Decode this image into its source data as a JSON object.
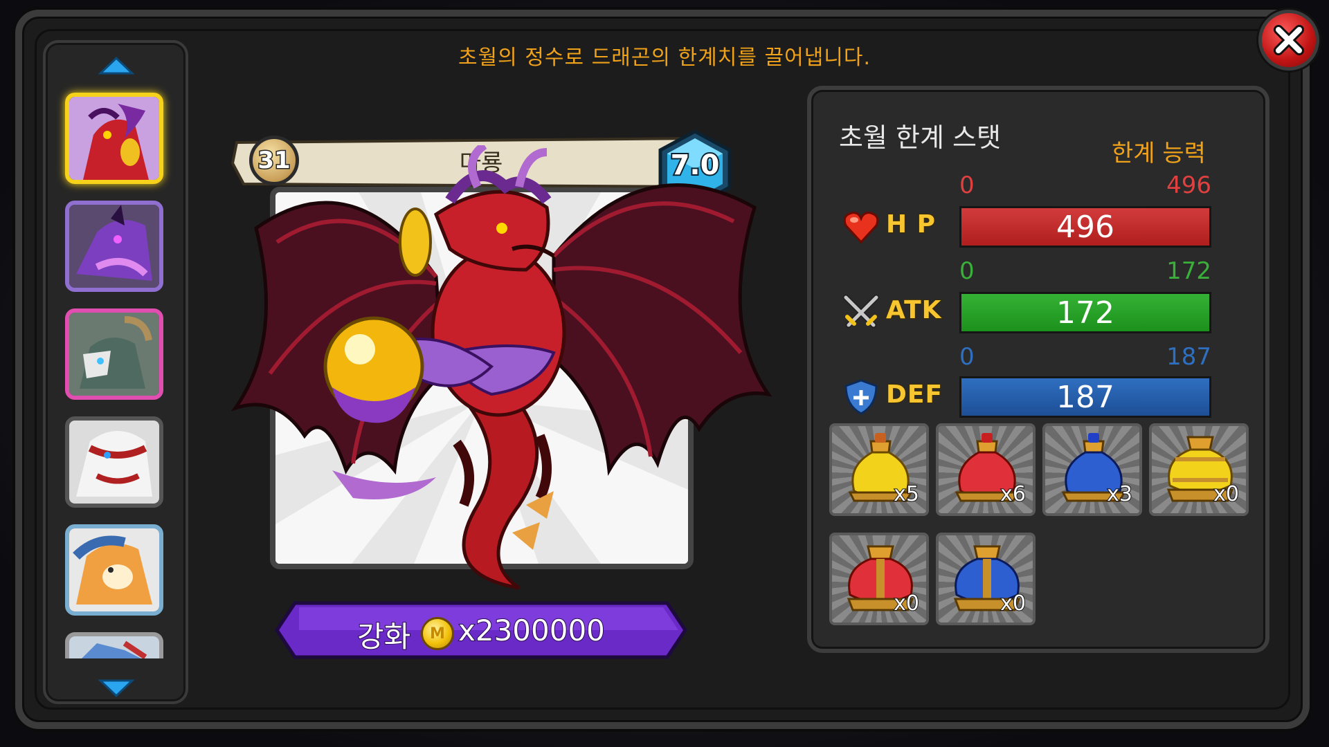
{
  "headline": "초월의 정수로 드래곤의 한계치를 끌어냅니다.",
  "close_icon": "close-icon",
  "roster": {
    "up_icon": "arrow-up-icon",
    "down_icon": "arrow-down-icon",
    "thumbnails": [
      {
        "name": "red-demon-dragon",
        "frame": "#f6d21a",
        "selected": true
      },
      {
        "name": "purple-shadow-dragon",
        "frame": "#8f6fd0",
        "selected": false
      },
      {
        "name": "horned-skull-dragon",
        "frame": "#e04fb0",
        "selected": false
      },
      {
        "name": "white-red-dragon",
        "frame": "#555555",
        "selected": false
      },
      {
        "name": "blue-orange-dragon",
        "frame": "#7aaed0",
        "selected": false
      },
      {
        "name": "blue-red-dragon",
        "frame": "#9a9a9a",
        "selected": false
      }
    ]
  },
  "dragon": {
    "name": "마룡",
    "level": "31",
    "grade": "7.0"
  },
  "enhance": {
    "label": "강화",
    "coin_symbol": "M",
    "cost": "x2300000"
  },
  "stats": {
    "title": "초월 한계 스탯",
    "subtitle": "한계 능력",
    "hp": {
      "label": "H P",
      "min": "0",
      "max": "496",
      "value": "496",
      "fraction": 1.0,
      "color": "#d23b3b"
    },
    "atk": {
      "label": "ATK",
      "min": "0",
      "max": "172",
      "value": "172",
      "fraction": 1.0,
      "color": "#35b235"
    },
    "def": {
      "label": "DEF",
      "min": "0",
      "max": "187",
      "value": "187",
      "fraction": 1.0,
      "color": "#2f6fc0"
    }
  },
  "items": [
    {
      "name": "yellow-potion",
      "count": "x5",
      "color": "#f2d21a"
    },
    {
      "name": "red-potion",
      "count": "x6",
      "color": "#e0303a"
    },
    {
      "name": "blue-potion",
      "count": "x3",
      "color": "#2d5fd0"
    },
    {
      "name": "large-yellow-potion",
      "count": "x0",
      "color": "#f2d21a"
    },
    {
      "name": "large-red-potion",
      "count": "x0",
      "color": "#e0303a"
    },
    {
      "name": "large-blue-potion",
      "count": "x0",
      "color": "#2d5fd0"
    }
  ]
}
